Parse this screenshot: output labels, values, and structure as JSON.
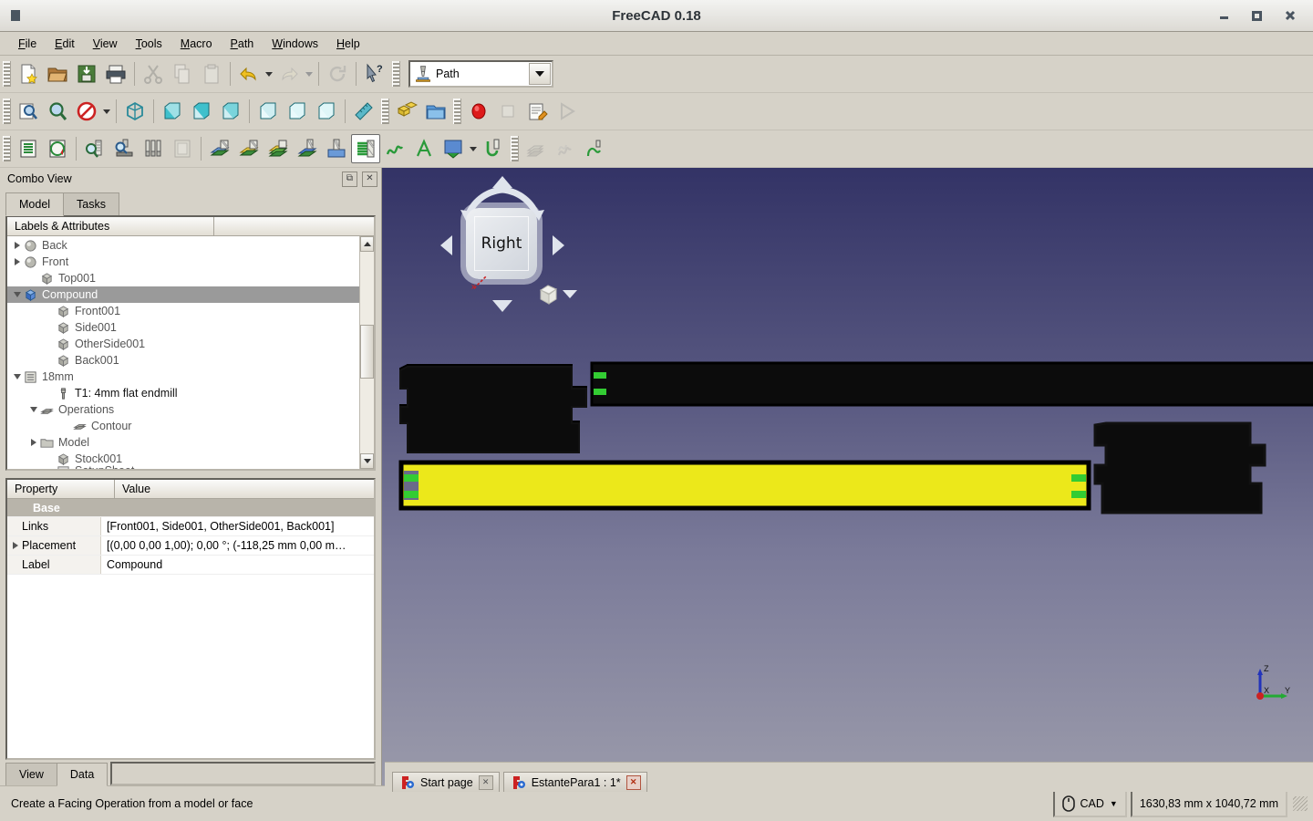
{
  "window": {
    "title": "FreeCAD 0.18",
    "minimize_label": "–",
    "maximize_label": "□",
    "close_label": "✕"
  },
  "menu": [
    {
      "label": "File",
      "mnemonic": "F"
    },
    {
      "label": "Edit",
      "mnemonic": "E"
    },
    {
      "label": "View",
      "mnemonic": "V"
    },
    {
      "label": "Tools",
      "mnemonic": "T"
    },
    {
      "label": "Macro",
      "mnemonic": "M"
    },
    {
      "label": "Path",
      "mnemonic": "P"
    },
    {
      "label": "Windows",
      "mnemonic": "W"
    },
    {
      "label": "Help",
      "mnemonic": "H"
    }
  ],
  "workbench": {
    "selected": "Path",
    "icon": "path-workbench-icon"
  },
  "toolbars": {
    "file": [
      "new-document-icon",
      "open-document-icon",
      "save-document-icon",
      "print-icon",
      "cut-icon",
      "copy-icon",
      "paste-icon",
      "undo-icon",
      "redo-icon",
      "refresh-icon",
      "whats-this-icon"
    ],
    "view": [
      "fit-all-icon",
      "fit-selection-icon",
      "draw-style-icon",
      "axonometric-view-icon",
      "front-view-icon",
      "top-view-icon",
      "right-view-icon",
      "rear-view-icon",
      "bottom-view-icon",
      "left-view-icon",
      "measure-icon",
      "workbench-part-icon",
      "create-group-icon",
      "record-macro-icon",
      "stop-macro-icon",
      "edit-macro-icon",
      "execute-macro-icon"
    ],
    "path": [
      "path-job-icon",
      "path-post-process-icon",
      "path-inspect-icon",
      "path-simulator-icon",
      "path-toolbit-library-icon",
      "path-sanity-check-icon",
      "path-profile-icon",
      "path-pocket-icon",
      "path-face-icon",
      "path-drilling-icon",
      "path-helix-icon",
      "path-adaptive-icon",
      "path-engrave-icon",
      "path-deburr-icon",
      "path-surface-icon",
      "path-slot-icon",
      "path-array-icon",
      "path-copy-icon",
      "path-dressup-icon"
    ]
  },
  "combo_view": {
    "title": "Combo View",
    "float_button": "⧉",
    "close_button": "✕",
    "tabs": [
      {
        "label": "Model",
        "selected": true
      },
      {
        "label": "Tasks",
        "selected": false
      }
    ],
    "tree_header": "Labels & Attributes",
    "tree": [
      {
        "label": "Back",
        "indent": 1,
        "twisty": "right",
        "icon": "sphere-shape-icon",
        "selected": false
      },
      {
        "label": "Front",
        "indent": 1,
        "twisty": "right",
        "icon": "sphere-shape-icon",
        "selected": false
      },
      {
        "label": "Top001",
        "indent": 2,
        "twisty": "none",
        "icon": "box-shape-icon",
        "selected": false
      },
      {
        "label": "Compound",
        "indent": 1,
        "twisty": "down",
        "icon": "compound-icon",
        "selected": true
      },
      {
        "label": "Front001",
        "indent": 3,
        "twisty": "none",
        "icon": "box-shape-icon",
        "selected": false
      },
      {
        "label": "Side001",
        "indent": 3,
        "twisty": "none",
        "icon": "box-shape-icon",
        "selected": false
      },
      {
        "label": "OtherSide001",
        "indent": 3,
        "twisty": "none",
        "icon": "box-shape-icon",
        "selected": false
      },
      {
        "label": "Back001",
        "indent": 3,
        "twisty": "none",
        "icon": "box-shape-icon",
        "selected": false
      },
      {
        "label": "18mm",
        "indent": 1,
        "twisty": "down",
        "icon": "path-job-icon",
        "selected": false
      },
      {
        "label": "T1: 4mm flat endmill",
        "indent": 3,
        "twisty": "none",
        "icon": "toolbit-icon",
        "dark": true,
        "selected": false
      },
      {
        "label": "Operations",
        "indent": 2,
        "twisty": "down",
        "icon": "operations-icon",
        "selected": false
      },
      {
        "label": "Contour",
        "indent": 4,
        "twisty": "none",
        "icon": "path-profile-icon",
        "selected": false
      },
      {
        "label": "Model",
        "indent": 2,
        "twisty": "right",
        "icon": "folder-icon",
        "selected": false
      },
      {
        "label": "Stock001",
        "indent": 3,
        "twisty": "none",
        "icon": "box-shape-icon",
        "selected": false
      },
      {
        "label": "SetupSheet",
        "indent": 3,
        "twisty": "none",
        "icon": "setup-sheet-icon",
        "selected": false,
        "clipped": true
      }
    ],
    "property_columns": [
      "Property",
      "Value"
    ],
    "properties": [
      {
        "name": "Base",
        "value": "",
        "group": true
      },
      {
        "name": "Links",
        "value": "[Front001, Side001, OtherSide001, Back001]",
        "expandable": false
      },
      {
        "name": "Placement",
        "value": "[(0,00 0,00 1,00); 0,00 °; (-118,25 mm  0,00 m…",
        "expandable": true
      },
      {
        "name": "Label",
        "value": "Compound",
        "expandable": false
      }
    ],
    "bottom_tabs": [
      {
        "label": "View",
        "selected": false
      },
      {
        "label": "Data",
        "selected": true
      }
    ]
  },
  "viewport": {
    "nav_cube": {
      "face_label": "Right",
      "left_arrow": "nav-arrow-left",
      "right_arrow": "nav-arrow-right",
      "up_arrow": "nav-arrow-up",
      "down_arrow": "nav-arrow-down",
      "home_icon": "nav-home-cube-icon",
      "dropdown_icon": "chevron-down-icon"
    },
    "axis_indicator": {
      "x": "X",
      "y": "Y",
      "z": "Z",
      "x_color": "#cc2222",
      "y_color": "#22aa33",
      "z_color": "#2233bb"
    },
    "background_top": "#333366",
    "background_bottom": "#9a9aaa",
    "selected_color": "#ece81a",
    "part_color": "#0c0c0c",
    "marker_color": "#33cc33"
  },
  "document_tabs": [
    {
      "label": "Start page",
      "icon": "freecad-icon",
      "close": "✕",
      "active": false
    },
    {
      "label": "EstantePara1 : 1*",
      "icon": "freecad-icon",
      "close": "✕",
      "active": true
    }
  ],
  "status": {
    "message": "Create a Facing Operation from a model or face",
    "nav_style": "CAD",
    "nav_icon": "mouse-icon",
    "dimensions": "1630,83 mm x 1040,72 mm"
  }
}
